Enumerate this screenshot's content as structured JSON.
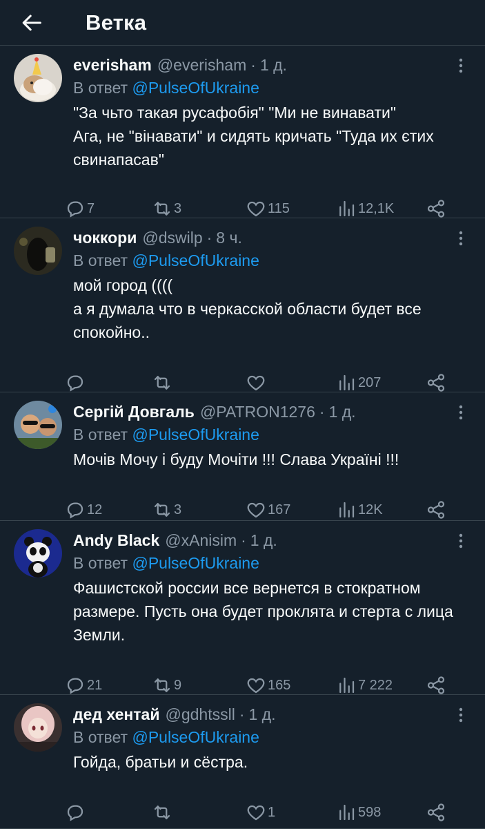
{
  "header": {
    "title": "Ветка"
  },
  "tweets": [
    {
      "name": "everisham",
      "handle": "@everisham",
      "time": "1 д.",
      "reply_prefix": "В ответ",
      "reply_to": "@PulseOfUkraine",
      "text": "\"За чьто такая русафобія\" \"Ми не винавати\"\nАга, не \"вінавати\" и сидять кричать \"Туда их єтих свинапасав\"",
      "replies": "7",
      "retweets": "3",
      "likes": "115",
      "views": "12,1K",
      "avatar_icon": "guinea-pig-party-hat"
    },
    {
      "name": "чоккори",
      "handle": "@dswilp",
      "time": "8 ч.",
      "reply_prefix": "В ответ",
      "reply_to": "@PulseOfUkraine",
      "text": "мой город ((((\nа я думала что в черкасской области будет все спокойно..",
      "replies": "",
      "retweets": "",
      "likes": "",
      "views": "207",
      "avatar_icon": "dark-figure"
    },
    {
      "name": "Сергій Довгаль",
      "handle": "@PATRON1276",
      "time": "1 д.",
      "reply_prefix": "В ответ",
      "reply_to": "@PulseOfUkraine",
      "text": "Мочів Мочу і буду Мочіти !!! Слава Україні !!!",
      "replies": "12",
      "retweets": "3",
      "likes": "167",
      "views": "12K",
      "avatar_icon": "two-men-sunglasses"
    },
    {
      "name": "Andy Black",
      "handle": "@xAnisim",
      "time": "1 д.",
      "reply_prefix": "В ответ",
      "reply_to": "@PulseOfUkraine",
      "text": "Фашистской россии все вернется в стократном размере. Пусть она будет проклята и стерта с лица Земли.",
      "replies": "21",
      "retweets": "9",
      "likes": "165",
      "views": "7 222",
      "avatar_icon": "panda"
    },
    {
      "name": "дед хентай",
      "handle": "@gdhtssll",
      "time": "1 д.",
      "reply_prefix": "В ответ",
      "reply_to": "@PulseOfUkraine",
      "text": "Гойда, братьи и сёстра.",
      "replies": "",
      "retweets": "",
      "likes": "1",
      "views": "598",
      "avatar_icon": "anime-girl"
    }
  ],
  "colors": {
    "background": "#15202b",
    "divider": "#38444d",
    "text_primary": "#f7f9f9",
    "text_secondary": "#8b98a5",
    "accent": "#1d9bf0"
  }
}
